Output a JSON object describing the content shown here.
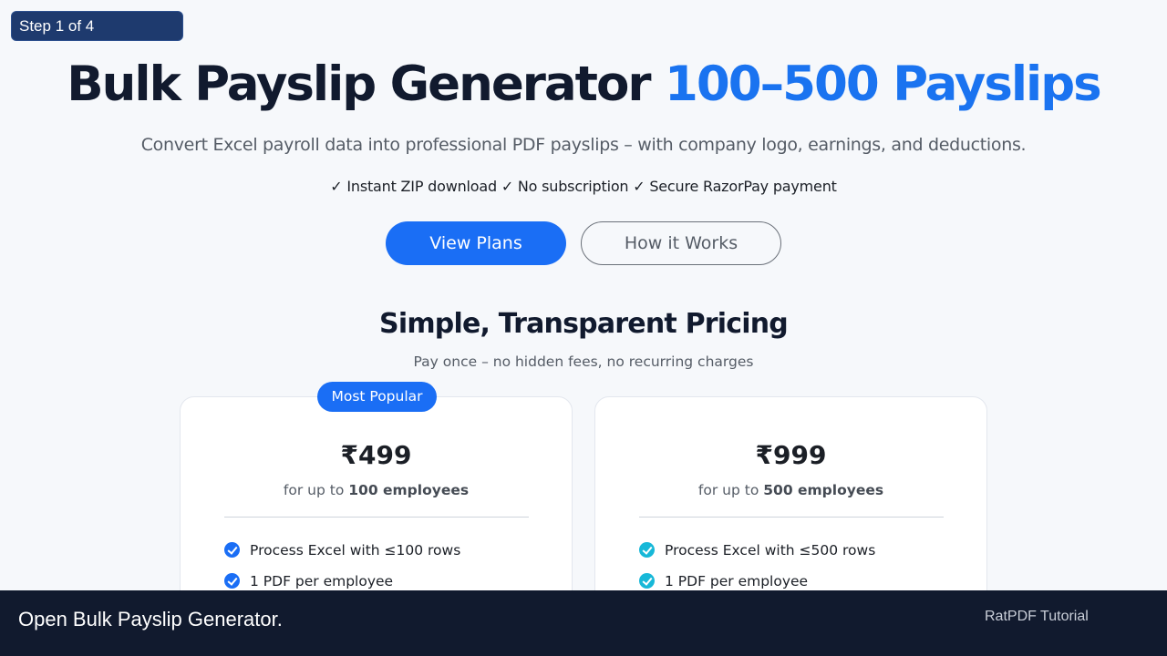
{
  "step_indicator": "Step 1 of 4",
  "hero": {
    "title": "Bulk Payslip Generator",
    "title_accent": "100–500 Payslips",
    "subtitle": "Convert Excel payroll data into professional PDF payslips – with company logo, earnings, and deductions.",
    "checks": "✓ Instant ZIP download ✓ No subscription ✓ Secure RazorPay payment",
    "primary_button": "View Plans",
    "secondary_button": "How it Works"
  },
  "pricing": {
    "title": "Simple, Transparent Pricing",
    "subtitle": "Pay once – no hidden fees, no recurring charges",
    "plans": [
      {
        "badge": "Most Popular",
        "price": "₹499",
        "note_prefix": "for up to ",
        "note_bold": "100 employees",
        "features": [
          "Process Excel with ≤100 rows",
          "1 PDF per employee"
        ]
      },
      {
        "price": "₹999",
        "note_prefix": "for up to ",
        "note_bold": "500 employees",
        "features": [
          "Process Excel with ≤500 rows",
          "1 PDF per employee"
        ]
      }
    ]
  },
  "footer": {
    "caption": "Open Bulk Payslip Generator.",
    "brand": "RatPDF Tutorial"
  },
  "colors": {
    "accent": "#1a6ef5",
    "navy": "#111a2e",
    "check_cyan": "#17b8d8",
    "step_pill": "#1e3a6e"
  },
  "icons": {
    "feature_check": "check-circle-icon"
  }
}
